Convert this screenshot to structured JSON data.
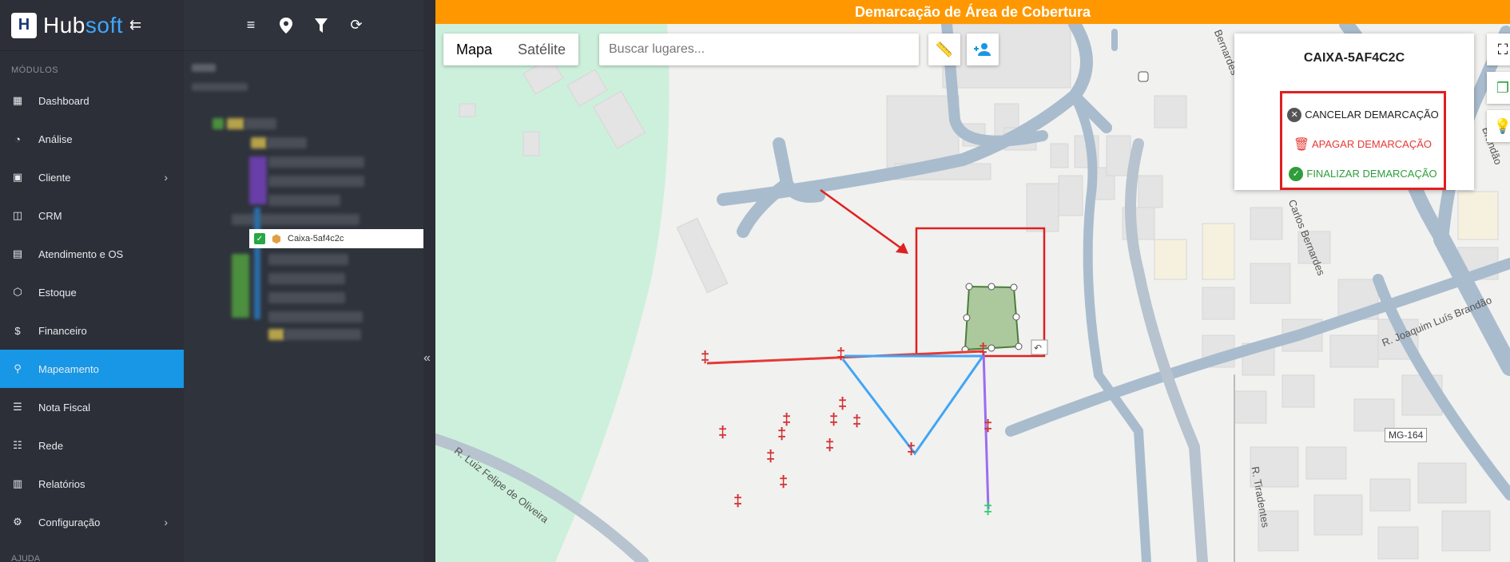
{
  "brand": {
    "name_part1": "Hub",
    "name_part2": "soft"
  },
  "sidebar": {
    "section_label": "MÓDULOS",
    "bottom_label": "AJUDA",
    "items": [
      {
        "label": "Dashboard",
        "icon": "dashboard-icon"
      },
      {
        "label": "Análise",
        "icon": "pie-chart-icon"
      },
      {
        "label": "Cliente",
        "icon": "id-card-icon",
        "has_children": true
      },
      {
        "label": "CRM",
        "icon": "board-icon"
      },
      {
        "label": "Atendimento e OS",
        "icon": "calendar-icon"
      },
      {
        "label": "Estoque",
        "icon": "cube-icon"
      },
      {
        "label": "Financeiro",
        "icon": "money-icon"
      },
      {
        "label": "Mapeamento",
        "icon": "map-pin-icon",
        "active": true
      },
      {
        "label": "Nota Fiscal",
        "icon": "invoice-icon"
      },
      {
        "label": "Rede",
        "icon": "server-icon"
      },
      {
        "label": "Relatórios",
        "icon": "report-icon"
      },
      {
        "label": "Configuração",
        "icon": "gear-icon",
        "has_children": true
      }
    ]
  },
  "tree": {
    "selected_item": "Caixa-5af4c2c"
  },
  "map": {
    "header_title": "Demarcação de Área de Cobertura",
    "map_type_options": [
      "Mapa",
      "Satélite"
    ],
    "map_type_selected": "Mapa",
    "search_placeholder": "Buscar lugares...",
    "road_labels": [
      "R. Luiz Felipe de Oliveira",
      "R. Tiradentes",
      "R. Joaquim Luís Brandão",
      "Carlos Bernardes",
      "Bernardes",
      "Brandão"
    ],
    "highway_badge": "MG-164"
  },
  "demarcation_panel": {
    "title": "CAIXA-5AF4C2C",
    "cancel_label": "CANCELAR DEMARCAÇÃO",
    "delete_label": "APAGAR DEMARCAÇÃO",
    "finish_label": "FINALIZAR DEMARCAÇÃO"
  },
  "colors": {
    "header": "#ff9800",
    "active_nav": "#1797e6",
    "cancel": "#555555",
    "delete": "#e53935",
    "finish": "#2e9d3b",
    "highlight_box": "#e02020"
  }
}
